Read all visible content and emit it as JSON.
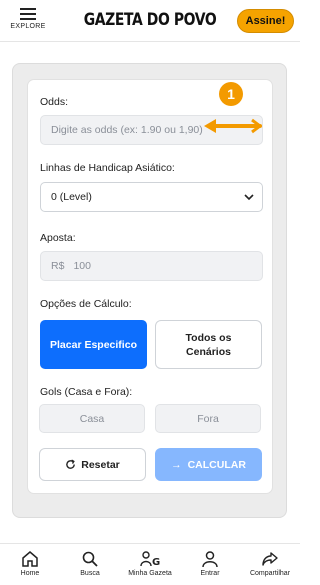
{
  "header": {
    "explore_label": "EXPLORE",
    "brand": "GAZETA DO POVO",
    "subscribe_label": "Assine!"
  },
  "form": {
    "odds_label": "Odds:",
    "odds_placeholder": "Digite as odds (ex: 1.90 ou 1,90)",
    "step_badge": "1",
    "handicap_label": "Linhas de Handicap Asiático:",
    "handicap_selected": "0 (Level)",
    "bet_label": "Aposta:",
    "bet_currency": "R$",
    "bet_value": "100",
    "calc_options_label": "Opções de Cálculo:",
    "option_specific": "Placar Especifico",
    "option_all": "Todos os Cenários",
    "goals_label": "Gols (Casa e Fora):",
    "home_placeholder": "Casa",
    "away_placeholder": "Fora",
    "reset_label": "Resetar",
    "calculate_label": "CALCULAR"
  },
  "bottom_nav": [
    {
      "label": "Home",
      "icon": "home-icon"
    },
    {
      "label": "Busca",
      "icon": "search-icon"
    },
    {
      "label": "Minha Gazeta",
      "icon": "my-gazeta-icon"
    },
    {
      "label": "Entrar",
      "icon": "user-icon"
    },
    {
      "label": "Compartilhar",
      "icon": "share-icon"
    }
  ],
  "colors": {
    "accent": "#f39a00",
    "primary": "#0d6efd",
    "primary_disabled": "#86b7fe"
  }
}
